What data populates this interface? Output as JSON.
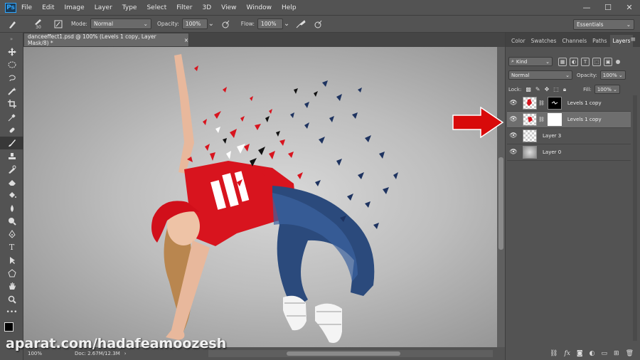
{
  "app": {
    "logo": "Ps"
  },
  "menubar": {
    "items": [
      "File",
      "Edit",
      "Image",
      "Layer",
      "Type",
      "Select",
      "Filter",
      "3D",
      "View",
      "Window",
      "Help"
    ]
  },
  "window_controls": {
    "minimize": "—",
    "maximize": "☐",
    "close": "✕"
  },
  "options_bar": {
    "brush_size": "30",
    "mode_label": "Mode:",
    "mode_value": "Normal",
    "opacity_label": "Opacity:",
    "opacity_value": "100%",
    "flow_label": "Flow:",
    "flow_value": "100%",
    "workspace": "Essentials"
  },
  "document": {
    "tab_title": "danceeffect1.psd @ 100% (Levels 1 copy, Layer Mask/8) *",
    "tab_close": "×",
    "zoom": "100%",
    "doc_info": "Doc: 2.67M/12.3M"
  },
  "panels": {
    "tabs": [
      "Color",
      "Swatches",
      "Channels",
      "Paths",
      "Layers"
    ],
    "active_tab": "Layers",
    "kind_filter": "Kind",
    "blend_mode": "Normal",
    "opacity_label": "Opacity:",
    "opacity_value": "100%",
    "lock_label": "Lock:",
    "fill_label": "Fill:",
    "fill_value": "100%"
  },
  "layers": [
    {
      "name": "Levels 1 copy",
      "thumb": "checker",
      "mask": "black",
      "selected": false
    },
    {
      "name": "Levels 1 copy",
      "thumb": "checker",
      "mask": "white",
      "selected": true
    },
    {
      "name": "Layer 3",
      "thumb": "checker",
      "mask": null,
      "selected": false
    },
    {
      "name": "Layer 0",
      "thumb": "grey",
      "mask": null,
      "selected": false
    }
  ],
  "watermark": "aparat.com/hadafeamoozesh",
  "colors": {
    "accent_arrow": "#d80a0a",
    "ps_blue": "#31a8ff"
  },
  "icons": {
    "toolbox": [
      "move-icon",
      "marquee-icon",
      "lasso-icon",
      "magic-wand-icon",
      "crop-icon",
      "eyedropper-icon",
      "healing-brush-icon",
      "brush-icon",
      "clone-stamp-icon",
      "history-brush-icon",
      "eraser-icon",
      "paint-bucket-icon",
      "blur-icon",
      "dodge-icon",
      "pen-icon",
      "type-icon",
      "path-select-icon",
      "shape-icon",
      "hand-icon",
      "zoom-icon",
      "more-tools-icon"
    ]
  }
}
